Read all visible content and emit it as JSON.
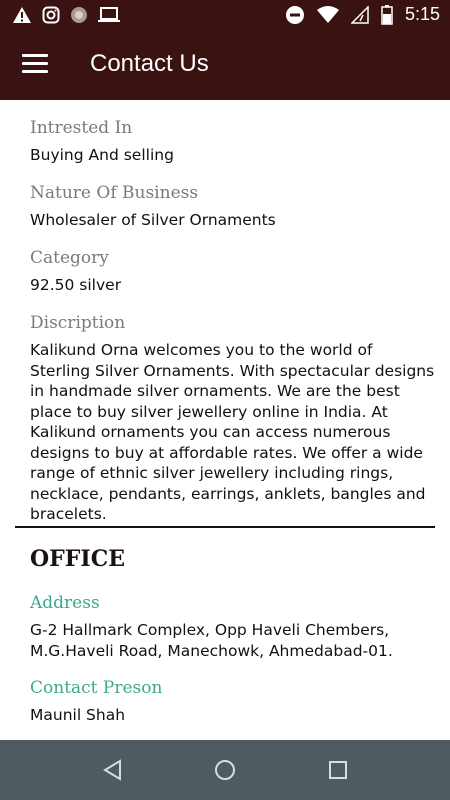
{
  "status_bar": {
    "time": "5:15",
    "left_icons": [
      "warning-icon",
      "instagram-icon",
      "circle-app-icon",
      "laptop-icon"
    ],
    "right_icons": [
      "do-not-disturb-icon",
      "wifi-icon",
      "signal-icon",
      "battery-icon"
    ]
  },
  "header": {
    "title": "Contact Us"
  },
  "fields": [
    {
      "label": "Intrested In",
      "value": "Buying And selling"
    },
    {
      "label": "Nature Of Business",
      "value": "Wholesaler of Silver Ornaments"
    },
    {
      "label": "Category",
      "value": "92.50 silver"
    },
    {
      "label": "Discription",
      "value": "Kalikund Orna welcomes you to the world of Sterling Silver Ornaments. With spectacular designs in handmade silver ornaments. We are the best place to buy silver jewellery online in India. At Kalikund ornaments you can access numerous designs to buy at affordable rates. We offer a wide range of ethnic silver jewellery including rings, necklace, pendants, earrings, anklets, bangles and bracelets."
    }
  ],
  "office": {
    "title": "OFFICE",
    "address_label": "Address",
    "address_value": "G-2 Hallmark Complex, Opp Haveli Chembers, M.G.Haveli Road, Manechowk, Ahmedabad-01.",
    "contact_label": "Contact Preson",
    "contact_value": "Maunil Shah"
  },
  "colors": {
    "primary": "#3a1212",
    "accent_label": "#3aa98f",
    "nav_bar": "#4e5b61"
  }
}
